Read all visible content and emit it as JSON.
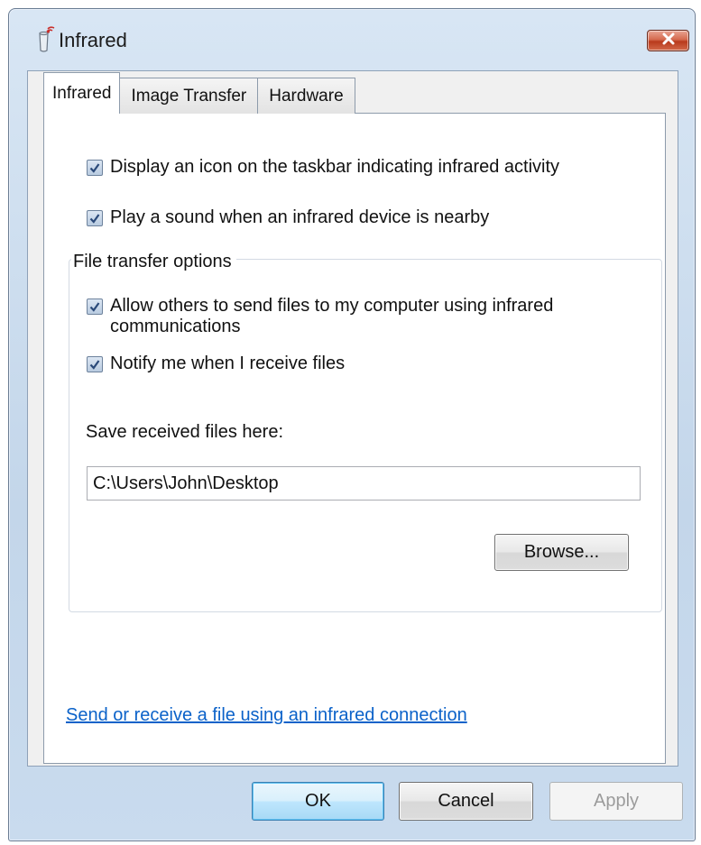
{
  "window": {
    "title": "Infrared",
    "icon": "infrared-device-icon",
    "close_icon": "close-icon"
  },
  "tabs": [
    {
      "label": "Infrared",
      "active": true
    },
    {
      "label": "Image Transfer",
      "active": false
    },
    {
      "label": "Hardware",
      "active": false
    }
  ],
  "options": {
    "taskbar_icon": {
      "label": "Display an icon on the taskbar indicating infrared activity",
      "checked": true
    },
    "play_sound": {
      "label": "Play a sound when an infrared device is nearby",
      "checked": true
    }
  },
  "file_transfer": {
    "legend": "File transfer options",
    "allow_send": {
      "label_line1": "Allow others to send files to my computer using infrared",
      "label_line2": "communications",
      "checked": true
    },
    "notify": {
      "label": "Notify me when I receive files",
      "checked": true
    },
    "save_label": "Save received files here:",
    "save_path": "C:\\Users\\John\\Desktop",
    "browse_label": "Browse..."
  },
  "link": {
    "text": "Send or receive a file using an infrared connection"
  },
  "buttons": {
    "ok": "OK",
    "cancel": "Cancel",
    "apply": "Apply"
  },
  "colors": {
    "accent": "#3c7fb1",
    "link": "#0b62c9",
    "close": "#c9492b"
  }
}
